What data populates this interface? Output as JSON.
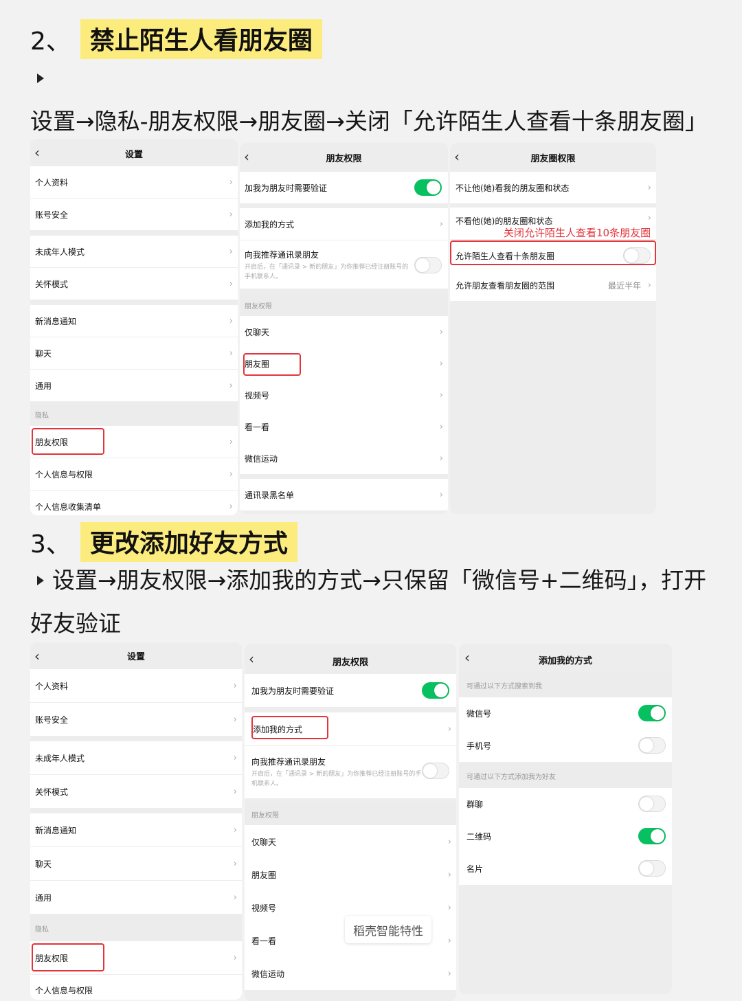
{
  "section2": {
    "number": "2、",
    "title": "禁止陌生人看朋友圈",
    "desc": "设置→隐私-朋友权限→朋友圈→关闭「允许陌生人查看十条朋友圈」"
  },
  "section3": {
    "number": "3、",
    "title": "更改添加好友方式",
    "desc": "设置→朋友权限→添加我的方式→只保留「微信号+二维码」，打开好友验证"
  },
  "settings": {
    "title": "设置",
    "items": [
      "个人资料",
      "账号安全",
      "未成年人模式",
      "关怀模式",
      "新消息通知",
      "聊天",
      "通用",
      "朋友权限",
      "个人信息与权限",
      "个人信息收集清单"
    ],
    "privacy_header": "隐私"
  },
  "friend_perm": {
    "title": "朋友权限",
    "verify_label": "加我为朋友时需要验证",
    "verify_on": true,
    "add_methods": "添加我的方式",
    "recommend_label": "向我推荐通讯录朋友",
    "recommend_sub": "开启后，在「通讯录 > 新的朋友」为你推荐已经注册账号的手机联系人。",
    "recommend_on": false,
    "section_header": "朋友权限",
    "items": [
      "仅聊天",
      "朋友圈",
      "视频号",
      "看一看",
      "微信运动"
    ],
    "blacklist": "通讯录黑名单"
  },
  "moments_perm": {
    "title": "朋友圈权限",
    "items": [
      "不让他(她)看我的朋友圈和状态",
      "不看他(她)的朋友圈和状态"
    ],
    "annotation": "关闭允许陌生人查看10条朋友圈",
    "stranger_label": "允许陌生人查看十条朋友圈",
    "stranger_on": false,
    "range_label": "允许朋友查看朋友圈的范围",
    "range_value": "最近半年"
  },
  "add_methods": {
    "title": "添加我的方式",
    "search_header": "可通过以下方式搜索到我",
    "search_items": [
      {
        "label": "微信号",
        "on": true
      },
      {
        "label": "手机号",
        "on": false
      }
    ],
    "add_header": "可通过以下方式添加我为好友",
    "add_items": [
      {
        "label": "群聊",
        "on": false
      },
      {
        "label": "二维码",
        "on": true
      },
      {
        "label": "名片",
        "on": false
      }
    ]
  },
  "watermark": "稻壳智能特性",
  "colors": {
    "highlight": "#fcec7e",
    "toggle_on": "#07c160",
    "annotation": "#e2343a"
  }
}
